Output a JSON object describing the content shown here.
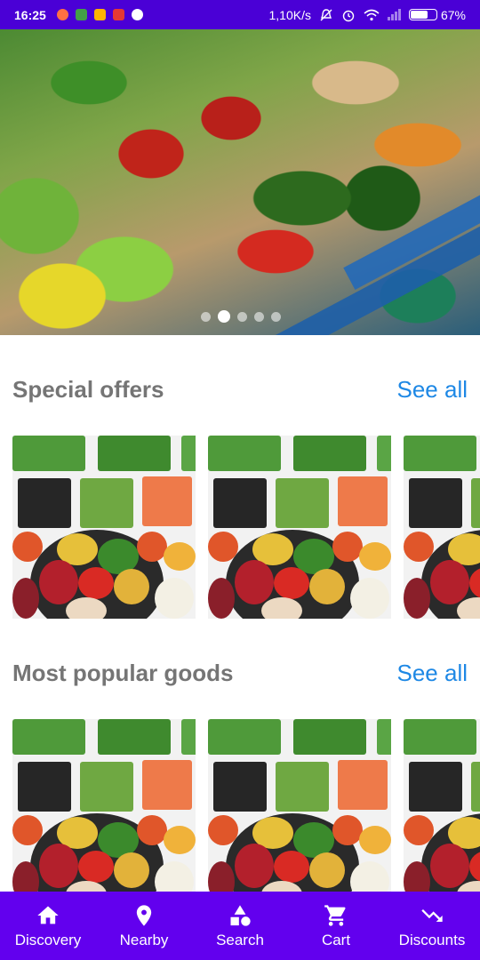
{
  "status_bar": {
    "time": "16:25",
    "network_speed": "1,10K/s",
    "battery_percent": "67%",
    "battery_level": 0.67,
    "notification_colors": [
      "#ff7043",
      "#43a047",
      "#ffb300",
      "#e53935",
      "#ffffff"
    ]
  },
  "banner": {
    "slide_count": 5,
    "active_slide": 2,
    "image": "vegetable-market-photo"
  },
  "sections": [
    {
      "title": "Special offers",
      "see_all": "See all",
      "items": [
        {
          "image": "vegetable-tray-photo"
        },
        {
          "image": "vegetable-tray-photo"
        },
        {
          "image": "vegetable-tray-photo"
        }
      ]
    },
    {
      "title": "Most popular goods",
      "see_all": "See all",
      "items": [
        {
          "image": "vegetable-tray-photo"
        },
        {
          "image": "vegetable-tray-photo"
        },
        {
          "image": "vegetable-tray-photo"
        }
      ]
    }
  ],
  "bottom_nav": {
    "items": [
      {
        "label": "Discovery",
        "icon": "home-icon"
      },
      {
        "label": "Nearby",
        "icon": "location-pin-icon"
      },
      {
        "label": "Search",
        "icon": "shapes-icon"
      },
      {
        "label": "Cart",
        "icon": "cart-icon"
      },
      {
        "label": "Discounts",
        "icon": "trending-down-icon"
      }
    ]
  },
  "colors": {
    "status_bar": "#4a00d6",
    "bottom_nav": "#6200ee",
    "link": "#1e88e5",
    "section_title": "#757575"
  }
}
